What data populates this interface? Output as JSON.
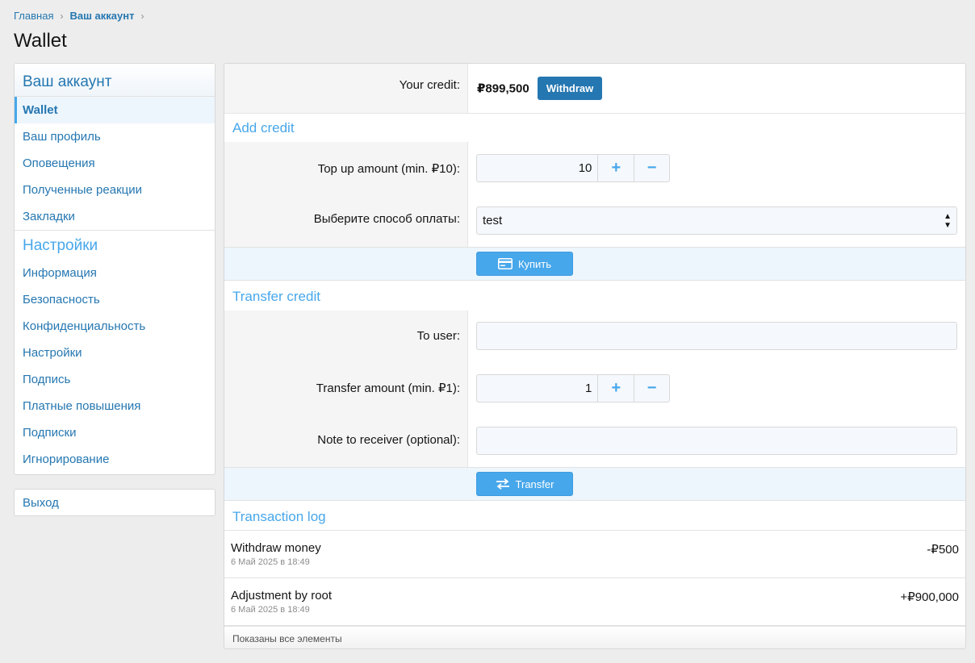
{
  "breadcrumb": {
    "home": "Главная",
    "account": "Ваш аккаунт"
  },
  "page_title": "Wallet",
  "sidebar": {
    "section1": "Ваш аккаунт",
    "items1": [
      "Wallet",
      "Ваш профиль",
      "Оповещения",
      "Полученные реакции",
      "Закладки"
    ],
    "section2": "Настройки",
    "items2": [
      "Информация",
      "Безопасность",
      "Конфиденциальность",
      "Настройки",
      "Подпись",
      "Платные повышения",
      "Подписки",
      "Игнорирование"
    ],
    "logout": "Выход"
  },
  "credit": {
    "label": "Your credit:",
    "value": "₽899,500",
    "withdraw": "Withdraw"
  },
  "add_credit": {
    "title": "Add credit",
    "amount_label": "Top up amount (min. ₽10):",
    "amount_value": "10",
    "plus": "+",
    "minus": "−",
    "method_label": "Выберите способ оплаты:",
    "method_value": "test",
    "buy_button": "Купить"
  },
  "transfer": {
    "title": "Transfer credit",
    "to_label": "To user:",
    "amount_label": "Transfer amount (min. ₽1):",
    "amount_value": "1",
    "plus": "+",
    "minus": "−",
    "note_label": "Note to receiver (optional):",
    "button": "Transfer"
  },
  "log": {
    "title": "Transaction log",
    "rows": [
      {
        "title": "Withdraw money",
        "date": "6 Май 2025 в 18:49",
        "amount": "-₽500"
      },
      {
        "title": "Adjustment by root",
        "date": "6 Май 2025 в 18:49",
        "amount": "+₽900,000"
      }
    ],
    "footer": "Показаны все элементы"
  },
  "colors": {
    "link": "#2577b1",
    "accent": "#47a7eb",
    "button": "#47a7eb",
    "withdraw": "#2577b1"
  }
}
